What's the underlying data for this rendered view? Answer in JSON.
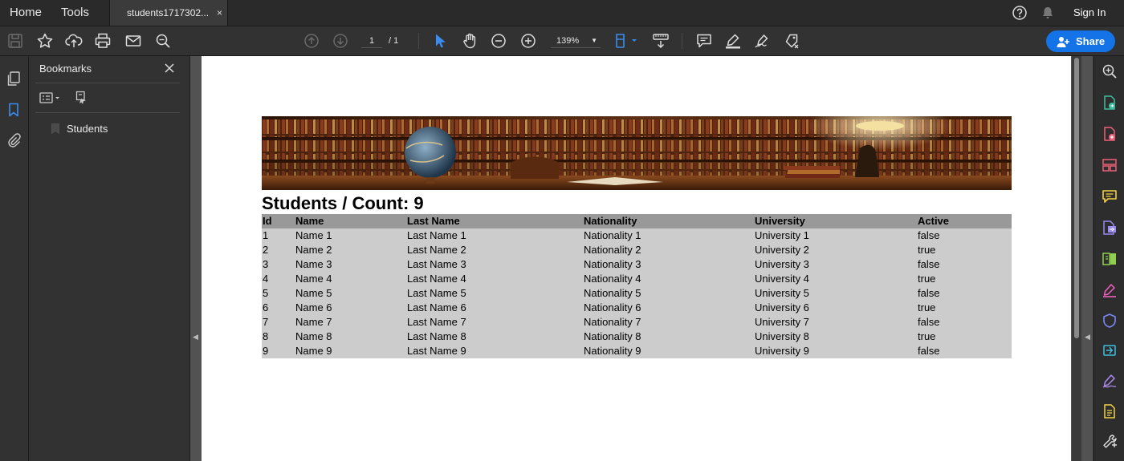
{
  "topbar": {
    "home": "Home",
    "tools": "Tools",
    "tab_title": "students1717302...",
    "tab_close": "×",
    "sign_in": "Sign In"
  },
  "toolbar": {
    "page_current": "1",
    "page_total": "/ 1",
    "zoom": "139%",
    "zoom_caret": "▼",
    "share_label": "Share"
  },
  "bookmarks": {
    "title": "Bookmarks",
    "items": [
      "Students"
    ]
  },
  "document": {
    "title": "Students / Count: 9",
    "columns": [
      "Id",
      "Name",
      "Last Name",
      "Nationality",
      "University",
      "Active"
    ],
    "rows": [
      [
        "1",
        "Name 1",
        "Last Name 1",
        "Nationality 1",
        "University 1",
        "false"
      ],
      [
        "2",
        "Name 2",
        "Last Name 2",
        "Nationality 2",
        "University 2",
        "true"
      ],
      [
        "3",
        "Name 3",
        "Last Name 3",
        "Nationality 3",
        "University 3",
        "false"
      ],
      [
        "4",
        "Name 4",
        "Last Name 4",
        "Nationality 4",
        "University 4",
        "true"
      ],
      [
        "5",
        "Name 5",
        "Last Name 5",
        "Nationality 5",
        "University 5",
        "false"
      ],
      [
        "6",
        "Name 6",
        "Last Name 6",
        "Nationality 6",
        "University 6",
        "true"
      ],
      [
        "7",
        "Name 7",
        "Last Name 7",
        "Nationality 7",
        "University 7",
        "false"
      ],
      [
        "8",
        "Name 8",
        "Last Name 8",
        "Nationality 8",
        "University 8",
        "true"
      ],
      [
        "9",
        "Name 9",
        "Last Name 9",
        "Nationality 9",
        "University 9",
        "false"
      ]
    ]
  },
  "colors": {
    "accent": "#1473e6",
    "header_row": "#999999",
    "data_row": "#cccccc"
  },
  "icons": {
    "toolbar": [
      "save-icon",
      "star-icon",
      "upload-icon",
      "print-icon",
      "mail-icon",
      "zoom-search-icon",
      "page-up-icon",
      "page-down-icon",
      "select-cursor-icon",
      "hand-icon",
      "zoom-out-icon",
      "zoom-in-icon",
      "fit-page-icon",
      "scroll-mode-icon",
      "comment-icon",
      "highlight-icon",
      "sign-icon",
      "stamp-icon"
    ],
    "right_rail": [
      "search-zoom-icon",
      "export-pdf-icon",
      "create-pdf-icon",
      "organize-pages-icon",
      "comment-tool-icon",
      "combine-files-icon",
      "edit-pdf-icon",
      "fill-sign-icon",
      "protect-icon",
      "send-review-icon",
      "request-signature-icon",
      "scan-icon",
      "more-tools-icon"
    ]
  }
}
